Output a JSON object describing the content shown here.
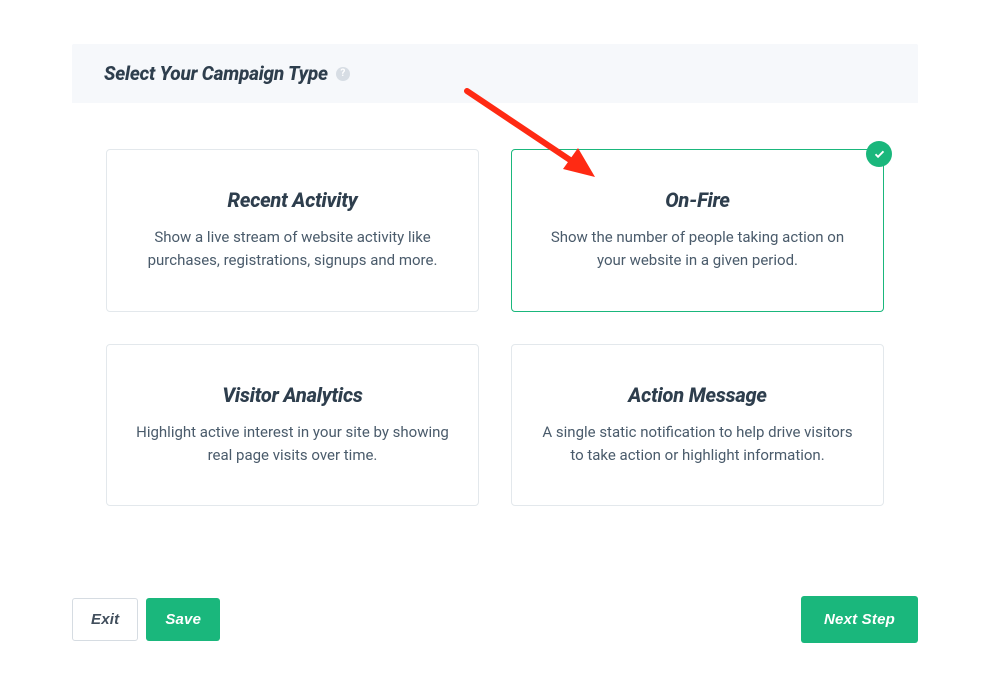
{
  "header": {
    "title": "Select Your Campaign Type"
  },
  "campaign_types": [
    {
      "title": "Recent Activity",
      "desc": "Show a live stream of website activity like purchases, registrations, signups and more.",
      "selected": false
    },
    {
      "title": "On-Fire",
      "desc": "Show the number of people taking action on your website in a given period.",
      "selected": true
    },
    {
      "title": "Visitor Analytics",
      "desc": "Highlight active interest in your site by showing real page visits over time.",
      "selected": false
    },
    {
      "title": "Action Message",
      "desc": "A single static notification to help drive visitors to take action or highlight information.",
      "selected": false
    }
  ],
  "footer": {
    "exit_label": "Exit",
    "save_label": "Save",
    "next_label": "Next Step"
  }
}
